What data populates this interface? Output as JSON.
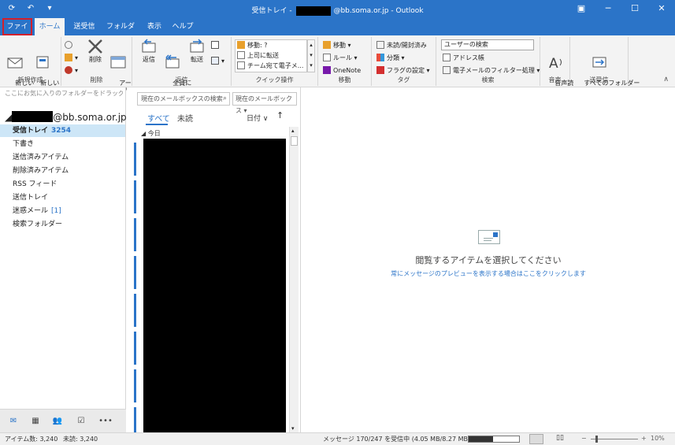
{
  "titlebar": {
    "title_prefix": "受信トレイ - ",
    "title_suffix": "@bb.soma.or.jp  -  Outlook",
    "qat_icons": [
      "send-receive-icon",
      "undo-icon",
      "customize-icon"
    ],
    "window_controls": [
      "ribbon-display-icon",
      "minimize-icon",
      "maximize-icon",
      "close-icon"
    ]
  },
  "tabs": [
    "ファイル",
    "ホーム",
    "送受信",
    "フォルダー",
    "表示",
    "ヘルプ"
  ],
  "ribbon": {
    "new": {
      "new_mail": "新しい\nメール",
      "new_items": "新しい\nアイテム ▾",
      "label": "新規作成"
    },
    "delete": {
      "delete": "削除",
      "archive": "アー\nカイブ",
      "label": "削除"
    },
    "respond": {
      "reply": "返信",
      "reply_all": "全員に\n返信",
      "forward": "転送",
      "label": "返信"
    },
    "quicksteps": {
      "items": [
        "移動: ?",
        "上司に転送",
        "チーム宛て電子メ..."
      ],
      "label": "クイック操作"
    },
    "move": {
      "move": "移動 ▾",
      "rules": "ルール ▾",
      "onenote": "OneNote",
      "label": "移動"
    },
    "tags": {
      "read_unread": "未読/開封済み",
      "categorize": "分類 ▾",
      "follow_up": "フラグの設定 ▾",
      "label": "タグ"
    },
    "find": {
      "search_people": "ユーザーの検索",
      "address_book": "アドレス帳",
      "filter_email": "電子メールのフィルター処理 ▾",
      "label": "検索"
    },
    "speech": {
      "read_aloud": "音声読\nみ上げ",
      "label": "音声"
    },
    "sendreceive": {
      "send_all": "すべてのフォルダー\nを送受信",
      "label": "送受信"
    }
  },
  "folderpane": {
    "fav_hint": "ここにお気に入りのフォルダーをドラッグします",
    "account_suffix": "@bb.soma.or.jp",
    "folders": [
      {
        "name": "受信トレイ",
        "count": "3254"
      },
      {
        "name": "下書き",
        "count": ""
      },
      {
        "name": "送信済みアイテム",
        "count": ""
      },
      {
        "name": "削除済みアイテム",
        "count": ""
      },
      {
        "name": "RSS フィード",
        "count": ""
      },
      {
        "name": "送信トレイ",
        "count": ""
      },
      {
        "name": "迷惑メール",
        "count": "[1]"
      },
      {
        "name": "検索フォルダー",
        "count": ""
      }
    ]
  },
  "listpane": {
    "search_placeholder": "現在のメールボックスの検索",
    "scope": "現在のメールボックス",
    "filter_all": "すべて",
    "filter_unread": "未読",
    "sort": "日付 ∨",
    "group_today": "今日"
  },
  "readpane": {
    "message": "閲覧するアイテムを選択してください",
    "link": "常にメッセージのプレビューを表示する場合はここをクリックします"
  },
  "statusbar": {
    "items": "アイテム数: 3,240",
    "unread": "未読: 3,240",
    "receiving": "メッセージ 170/247 を受信中 (4.05 MB/8.27 MB)",
    "progress": 0.49,
    "zoom": "10%"
  }
}
